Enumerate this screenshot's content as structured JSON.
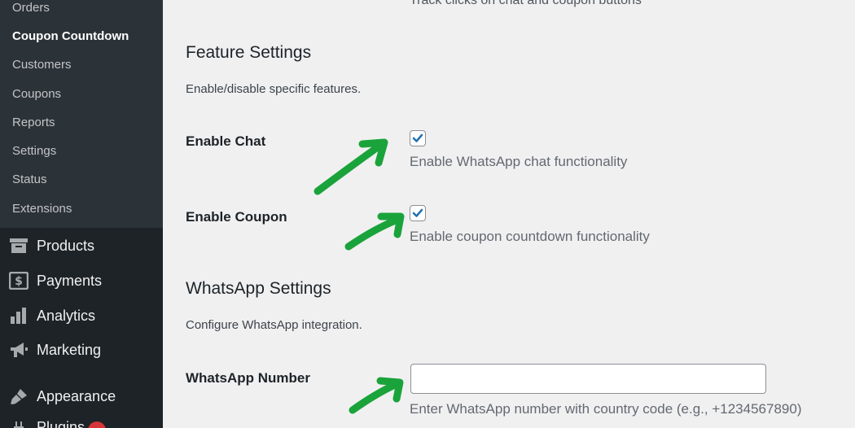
{
  "sidebar": {
    "submenu": [
      "Orders",
      "Coupon Countdown",
      "Customers",
      "Coupons",
      "Reports",
      "Settings",
      "Status",
      "Extensions"
    ],
    "active_submenu": "Coupon Countdown",
    "menu": [
      {
        "label": "Products",
        "icon": "archive-icon"
      },
      {
        "label": "Payments",
        "icon": "dollar-icon"
      },
      {
        "label": "Analytics",
        "icon": "bar-chart-icon"
      },
      {
        "label": "Marketing",
        "icon": "megaphone-icon"
      },
      {
        "label": "Appearance",
        "icon": "paintbrush-icon"
      },
      {
        "label": "Plugins",
        "icon": "plugin-icon"
      }
    ]
  },
  "main": {
    "top_desc": "Track clicks on chat and coupon buttons",
    "feature_settings": {
      "title": "Feature Settings",
      "desc": "Enable/disable specific features.",
      "enable_chat": {
        "label": "Enable Chat",
        "checked": true,
        "desc": "Enable WhatsApp chat functionality"
      },
      "enable_coupon": {
        "label": "Enable Coupon",
        "checked": true,
        "desc": "Enable coupon countdown functionality"
      }
    },
    "whatsapp_settings": {
      "title": "WhatsApp Settings",
      "desc": "Configure WhatsApp integration.",
      "number": {
        "label": "WhatsApp Number",
        "value": "",
        "desc": "Enter WhatsApp number with country code (e.g., +1234567890)"
      }
    }
  },
  "colors": {
    "sidebar_bg": "#1d2327",
    "submenu_bg": "#2c3338",
    "accent": "#2271b1",
    "arrow": "#1aa33a",
    "badge": "#d63638"
  }
}
